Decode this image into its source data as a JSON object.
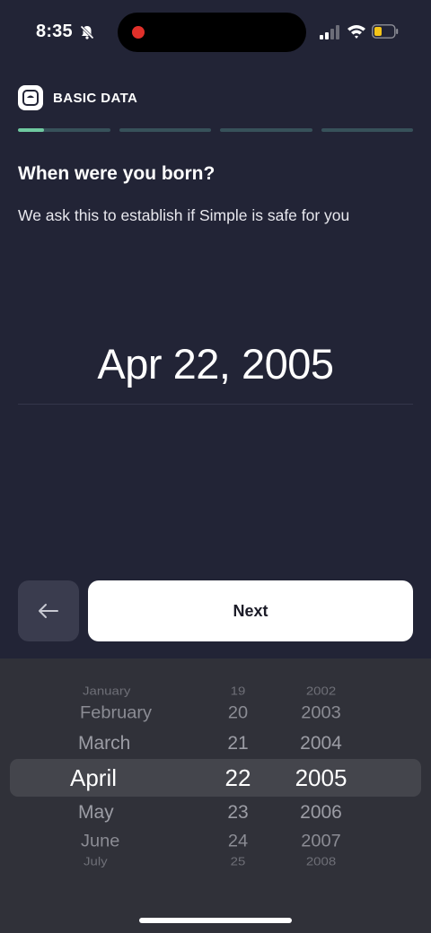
{
  "status_bar": {
    "time": "8:35"
  },
  "header": {
    "section_label": "BASIC DATA"
  },
  "progress": {
    "steps": [
      0.28,
      0,
      0,
      0
    ],
    "active_color": "#6fc9a0",
    "inactive_color": "#37515a"
  },
  "question": "When were you born?",
  "subtitle": "We ask this to establish if Simple is safe for you",
  "selected_date": "Apr 22, 2005",
  "buttons": {
    "next": "Next"
  },
  "picker": {
    "months": [
      "January",
      "February",
      "March",
      "April",
      "May",
      "June",
      "July"
    ],
    "days": [
      "19",
      "20",
      "21",
      "22",
      "23",
      "24",
      "25"
    ],
    "years": [
      "2002",
      "2003",
      "2004",
      "2005",
      "2006",
      "2007",
      "2008"
    ],
    "selected_month": "April",
    "selected_day": "22",
    "selected_year": "2005"
  }
}
